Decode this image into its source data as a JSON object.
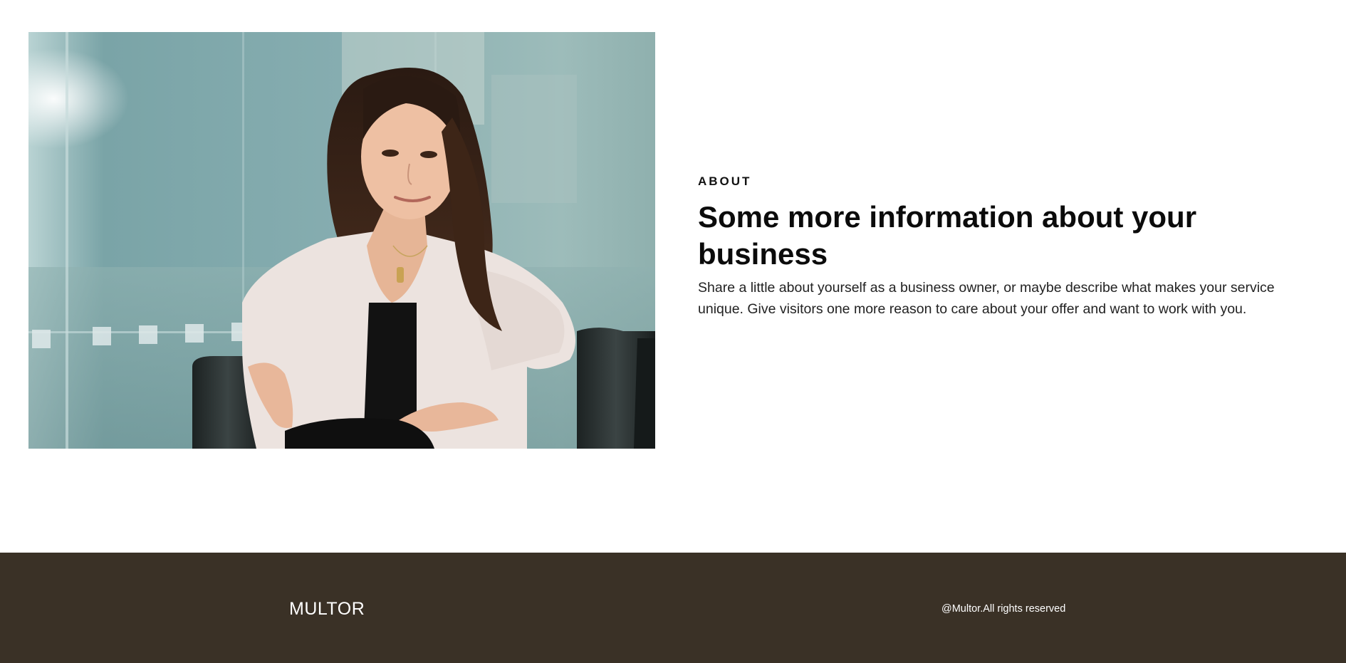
{
  "about": {
    "eyebrow": "ABOUT",
    "headline": "Some more information about your business",
    "body": "Share a little about yourself as a business owner, or maybe describe what makes your service unique. Give visitors one more reason to care about your offer and want to work with you."
  },
  "footer": {
    "brand": "MULTOR",
    "copyright": "@Multor.All rights reserved"
  },
  "colors": {
    "footer_background": "#3a3126",
    "text_dark": "#0b0b0b",
    "text_light": "#ffffff"
  }
}
